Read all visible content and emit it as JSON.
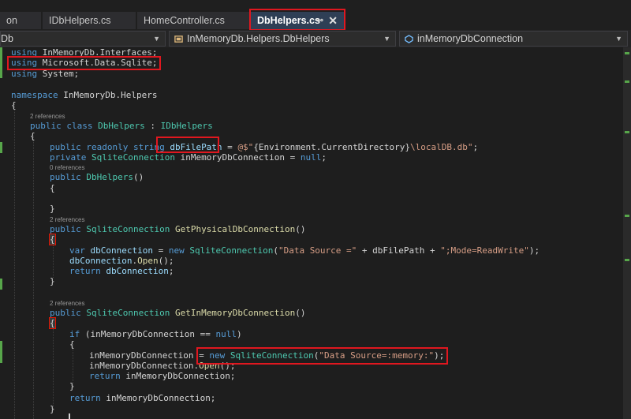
{
  "tabs": [
    {
      "label": "on"
    },
    {
      "label": "IDbHelpers.cs"
    },
    {
      "label": "HomeController.cs"
    },
    {
      "label": "DbHelpers.cs",
      "pin": "⊸",
      "close": "✕"
    }
  ],
  "navigation": {
    "project": "Db",
    "class": "InMemoryDb.Helpers.DbHelpers",
    "member": "inMemoryDbConnection",
    "dropdown_glyph": "▼"
  },
  "code_lens": {
    "class_refs": "2 references",
    "ctor_refs": "0 references",
    "physical_refs": "2 references",
    "inmemory_refs": "2 references"
  },
  "code": {
    "l1_kw": "using",
    "l1_rest": " InMemoryDb.Interfaces;",
    "l2_kw": "using",
    "l2_rest": " Microsoft.Data.Sqlite;",
    "l3_kw": "using",
    "l3_rest": " System;",
    "l5_kw": "namespace",
    "l5_rest": " InMemoryDb.Helpers",
    "open_brace": "{",
    "close_brace": "}",
    "l7_kw": "public class ",
    "l7_ty": "DbHelpers",
    "l7_mid": " : ",
    "l7_iface": "IDbHelpers",
    "l9_kw": "public readonly string ",
    "l9_var": "dbFilePath",
    "l9_eq": " = ",
    "l9_str_a": "@$\"",
    "l9_interp": "{Environment.CurrentDirectory}",
    "l9_str_b": "\\localDB.db\"",
    "l9_end": ";",
    "l10_kw": "private ",
    "l10_ty": "SqliteConnection",
    "l10_rest": " inMemoryDbConnection = ",
    "l10_null": "null",
    "l10_end": ";",
    "l11_kw": "public ",
    "l11_mt": "DbHelpers",
    "l11_rest": "()",
    "l14_kw": "public ",
    "l14_ty": "SqliteConnection",
    "l14_sp": " ",
    "l14_mt": "GetPhysicalDbConnection",
    "l14_rest": "()",
    "l16_kw": "var ",
    "l16_var": "dbConnection",
    "l16_eq": " = ",
    "l16_new": "new ",
    "l16_ty": "SqliteConnection",
    "l16_p": "(",
    "l16_str1": "\"Data Source =\"",
    "l16_plus": " + dbFilePath + ",
    "l16_str2": "\";Mode=ReadWrite\"",
    "l16_end": ");",
    "l17_var": "dbConnection",
    "l17_dot": ".",
    "l17_mt": "Open",
    "l17_end": "();",
    "l18_kw": "return ",
    "l18_var": "dbConnection",
    "l18_end": ";",
    "l20_kw": "public ",
    "l20_ty": "SqliteConnection",
    "l20_sp": " ",
    "l20_mt": "GetInMemoryDbConnection",
    "l20_rest": "()",
    "l22_kw": "if ",
    "l22_rest": "(inMemoryDbConnection == ",
    "l22_null": "null",
    "l22_end": ")",
    "l24_a": "inMemoryDbConnection = ",
    "l24_new": "new ",
    "l24_ty": "SqliteConnection",
    "l24_p": "(",
    "l24_str": "\"Data Source=:memory:\"",
    "l24_end": ");",
    "l25_a": "inMemoryDbConnection.",
    "l25_mt": "Open",
    "l25_end": "();",
    "l26_kw": "return ",
    "l26_rest": "inMemoryDbConnection;",
    "l28_kw": "return ",
    "l28_rest": "inMemoryDbConnection;"
  },
  "colors": {
    "keyword": "#569cd6",
    "type": "#4ec9b0",
    "method": "#dcdcaa",
    "variable": "#9cdcfe",
    "string": "#d69d85",
    "highlight_box": "#e0171f",
    "change_bar": "#57a64a"
  }
}
